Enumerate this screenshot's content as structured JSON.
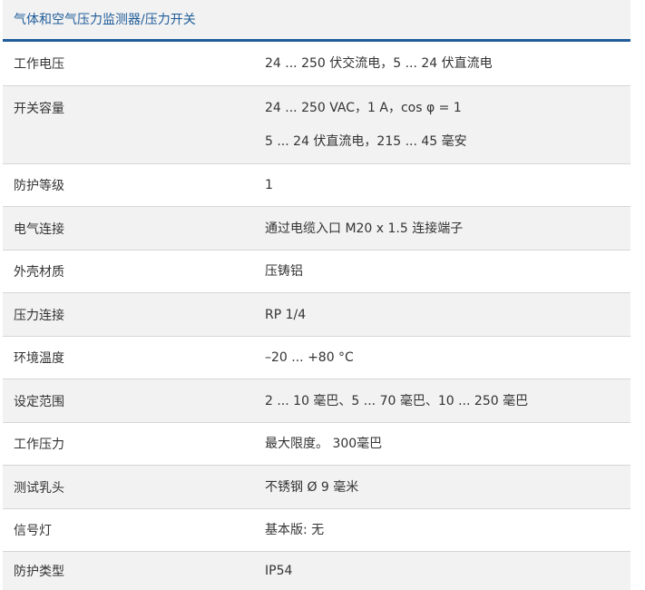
{
  "table": {
    "title": "气体和空气压力监测器/压力开关",
    "rows": [
      {
        "label": "工作电压",
        "values": [
          "24 ... 250 伏交流电，5 ... 24 伏直流电"
        ]
      },
      {
        "label": "开关容量",
        "values": [
          "24 ... 250 VAC，1 A，cos φ = 1",
          "5 ... 24 伏直流电，215 ... 45 毫安"
        ]
      },
      {
        "label": "防护等级",
        "values": [
          "1"
        ]
      },
      {
        "label": "电气连接",
        "values": [
          "通过电缆入口 M20 x 1.5 连接端子"
        ]
      },
      {
        "label": "外壳材质",
        "values": [
          "压铸铝"
        ]
      },
      {
        "label": "压力连接",
        "values": [
          "RP 1/4"
        ]
      },
      {
        "label": "环境温度",
        "values": [
          "–20 ... +80 °C"
        ]
      },
      {
        "label": "设定范围",
        "values": [
          "2 ... 10 毫巴、5 ... 70 毫巴、10 ... 250 毫巴"
        ]
      },
      {
        "label": "工作压力",
        "values": [
          "最大限度。 300毫巴"
        ]
      },
      {
        "label": "测试乳头",
        "values": [
          "不锈钢 Ø 9 毫米"
        ]
      },
      {
        "label": "信号灯",
        "values": [
          "基本版: 无"
        ]
      },
      {
        "label": "防护类型",
        "values": [
          "IP54"
        ]
      }
    ]
  }
}
